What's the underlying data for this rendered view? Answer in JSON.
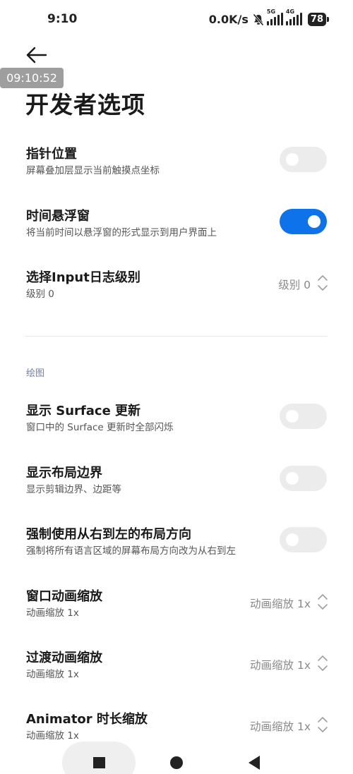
{
  "status_bar": {
    "time": "9:10",
    "speed": "0.0K/s",
    "sim1": "5G",
    "sim2": "4G",
    "battery": "78"
  },
  "header": {
    "overlay_time": "09:10:52",
    "title": "开发者选项"
  },
  "settings": [
    {
      "title": "指针位置",
      "subtitle": "屏幕叠加层显示当前触摸点坐标",
      "toggle": false
    },
    {
      "title": "时间悬浮窗",
      "subtitle": "将当前时间以悬浮窗的形式显示到用户界面上",
      "toggle": true
    },
    {
      "title": "选择Input日志级别",
      "subtitle": "级别 0",
      "value": "级别 0"
    }
  ],
  "section_drawing": "绘图",
  "drawing_settings": [
    {
      "title": "显示 Surface 更新",
      "subtitle": "窗口中的 Surface 更新时全部闪烁",
      "toggle": false
    },
    {
      "title": "显示布局边界",
      "subtitle": "显示剪辑边界、边距等",
      "toggle": false
    },
    {
      "title": "强制使用从右到左的布局方向",
      "subtitle": "强制将所有语言区域的屏幕布局方向改为从右到左",
      "toggle": false
    },
    {
      "title": "窗口动画缩放",
      "subtitle": "动画缩放 1x",
      "value": "动画缩放 1x"
    },
    {
      "title": "过渡动画缩放",
      "subtitle": "动画缩放 1x",
      "value": "动画缩放 1x"
    },
    {
      "title": "Animator 时长缩放",
      "subtitle": "动画缩放 1x",
      "value": "动画缩放 1x"
    }
  ],
  "colors": {
    "accent": "#0e73ea",
    "toggle_off": "#ececec",
    "section_label": "#6f7fa6"
  }
}
